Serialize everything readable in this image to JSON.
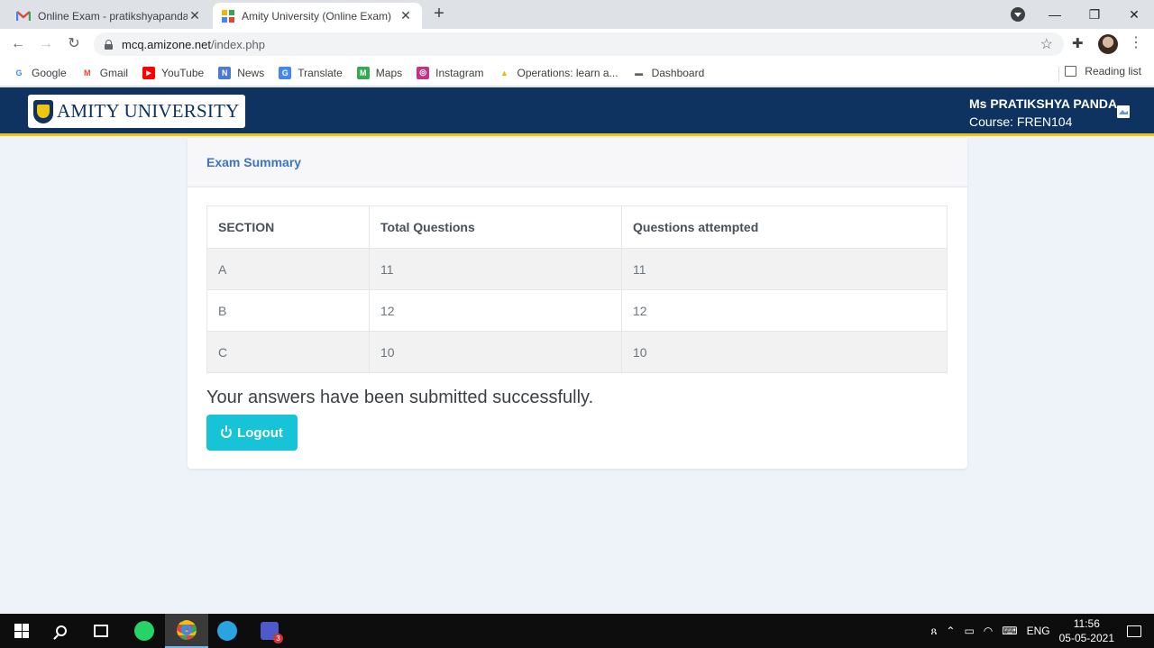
{
  "browser": {
    "tabs": [
      {
        "title": "Online Exam - pratikshyapanda2...",
        "close": "✕"
      },
      {
        "title": "Amity University (Online Exam)",
        "close": "✕"
      }
    ],
    "new_tab": "+",
    "url_host": "mcq.amizone.net",
    "url_path": "/index.php",
    "bookmarks": [
      {
        "label": "Google",
        "icon": "google-icon",
        "color": "#4285f4",
        "glyph": "G"
      },
      {
        "label": "Gmail",
        "icon": "gmail-icon",
        "color": "#ea4335",
        "glyph": "M"
      },
      {
        "label": "YouTube",
        "icon": "youtube-icon",
        "color": "#ff0000",
        "glyph": "▶"
      },
      {
        "label": "News",
        "icon": "news-icon",
        "color": "#4a7bd1",
        "glyph": "N"
      },
      {
        "label": "Translate",
        "icon": "translate-icon",
        "color": "#4285f4",
        "glyph": "G"
      },
      {
        "label": "Maps",
        "icon": "maps-icon",
        "color": "#34a853",
        "glyph": "M"
      },
      {
        "label": "Instagram",
        "icon": "instagram-icon",
        "color": "#c13584",
        "glyph": "◎"
      },
      {
        "label": "Operations: learn a...",
        "icon": "operations-icon",
        "color": "#f4b400",
        "glyph": "▲"
      },
      {
        "label": "Dashboard",
        "icon": "dashboard-icon",
        "color": "#5f6368",
        "glyph": "▬"
      }
    ],
    "reading_list": "Reading list"
  },
  "header": {
    "logo_text": "AMITY UNIVERSITY",
    "user_name": "Ms PRATIKSHYA PANDA",
    "course": "Course: FREN104"
  },
  "summary": {
    "title": "Exam Summary",
    "columns": [
      "SECTION",
      "Total Questions",
      "Questions attempted"
    ],
    "rows": [
      [
        "A",
        "11",
        "11"
      ],
      [
        "B",
        "12",
        "12"
      ],
      [
        "C",
        "10",
        "10"
      ]
    ],
    "message": "Your answers have been submitted successfully.",
    "logout_label": "Logout"
  },
  "taskbar": {
    "lang": "ENG",
    "time": "11:56",
    "date": "05-05-2021",
    "teams_badge": "3"
  },
  "colors": {
    "header_bg": "#0f3360",
    "accent_yellow": "#f1c40f",
    "logout_btn": "#17c3d6",
    "summary_title": "#3b74c4"
  }
}
